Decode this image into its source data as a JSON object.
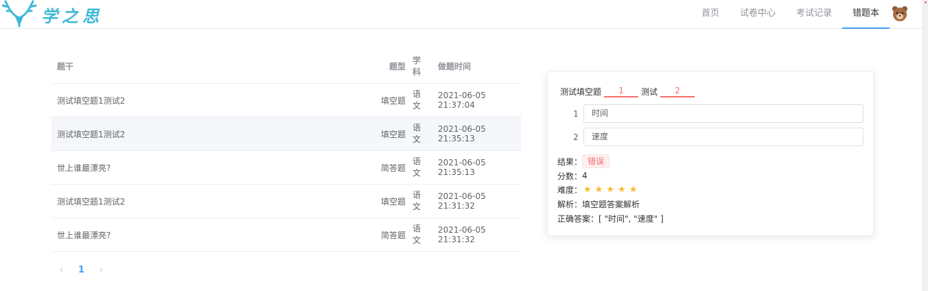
{
  "header": {
    "logo_text": "学之思",
    "nav": [
      {
        "label": "首页"
      },
      {
        "label": "试卷中心"
      },
      {
        "label": "考试记录"
      },
      {
        "label": "错题本",
        "active": true
      }
    ],
    "accent_color": "#409eff"
  },
  "table": {
    "columns": [
      "题干",
      "题型",
      "学科",
      "做题时间"
    ],
    "rows": [
      {
        "stem": "测试填空题1测试2",
        "type": "填空题",
        "subject": "语文",
        "time": "2021-06-05 21:37:04"
      },
      {
        "stem": "测试填空题1测试2",
        "type": "填空题",
        "subject": "语文",
        "time": "2021-06-05 21:35:13"
      },
      {
        "stem": "世上谁最漂亮?",
        "type": "简答题",
        "subject": "语文",
        "time": "2021-06-05 21:35:13"
      },
      {
        "stem": "测试填空题1测试2",
        "type": "填空题",
        "subject": "语文",
        "time": "2021-06-05 21:31:32"
      },
      {
        "stem": "世上谁最漂亮?",
        "type": "简答题",
        "subject": "语文",
        "time": "2021-06-05 21:31:32"
      }
    ]
  },
  "pagination": {
    "prev": "‹",
    "current": "1",
    "next": "›"
  },
  "detail": {
    "question": {
      "part1": "测试填空题",
      "blank1": "1",
      "part2": "测试",
      "blank2": "2"
    },
    "answers": [
      {
        "num": "1",
        "value": "时间"
      },
      {
        "num": "2",
        "value": "速度"
      }
    ],
    "result_label": "结果：",
    "result_value": "错误",
    "score_label": "分数：",
    "score_value": "4",
    "difficulty_label": "难度：",
    "difficulty_stars": 5,
    "analysis_label": "解析：",
    "analysis_value": "填空题答案解析",
    "correct_label": "正确答案：",
    "correct_value": "[ \"时间\", \"速度\" ]"
  }
}
